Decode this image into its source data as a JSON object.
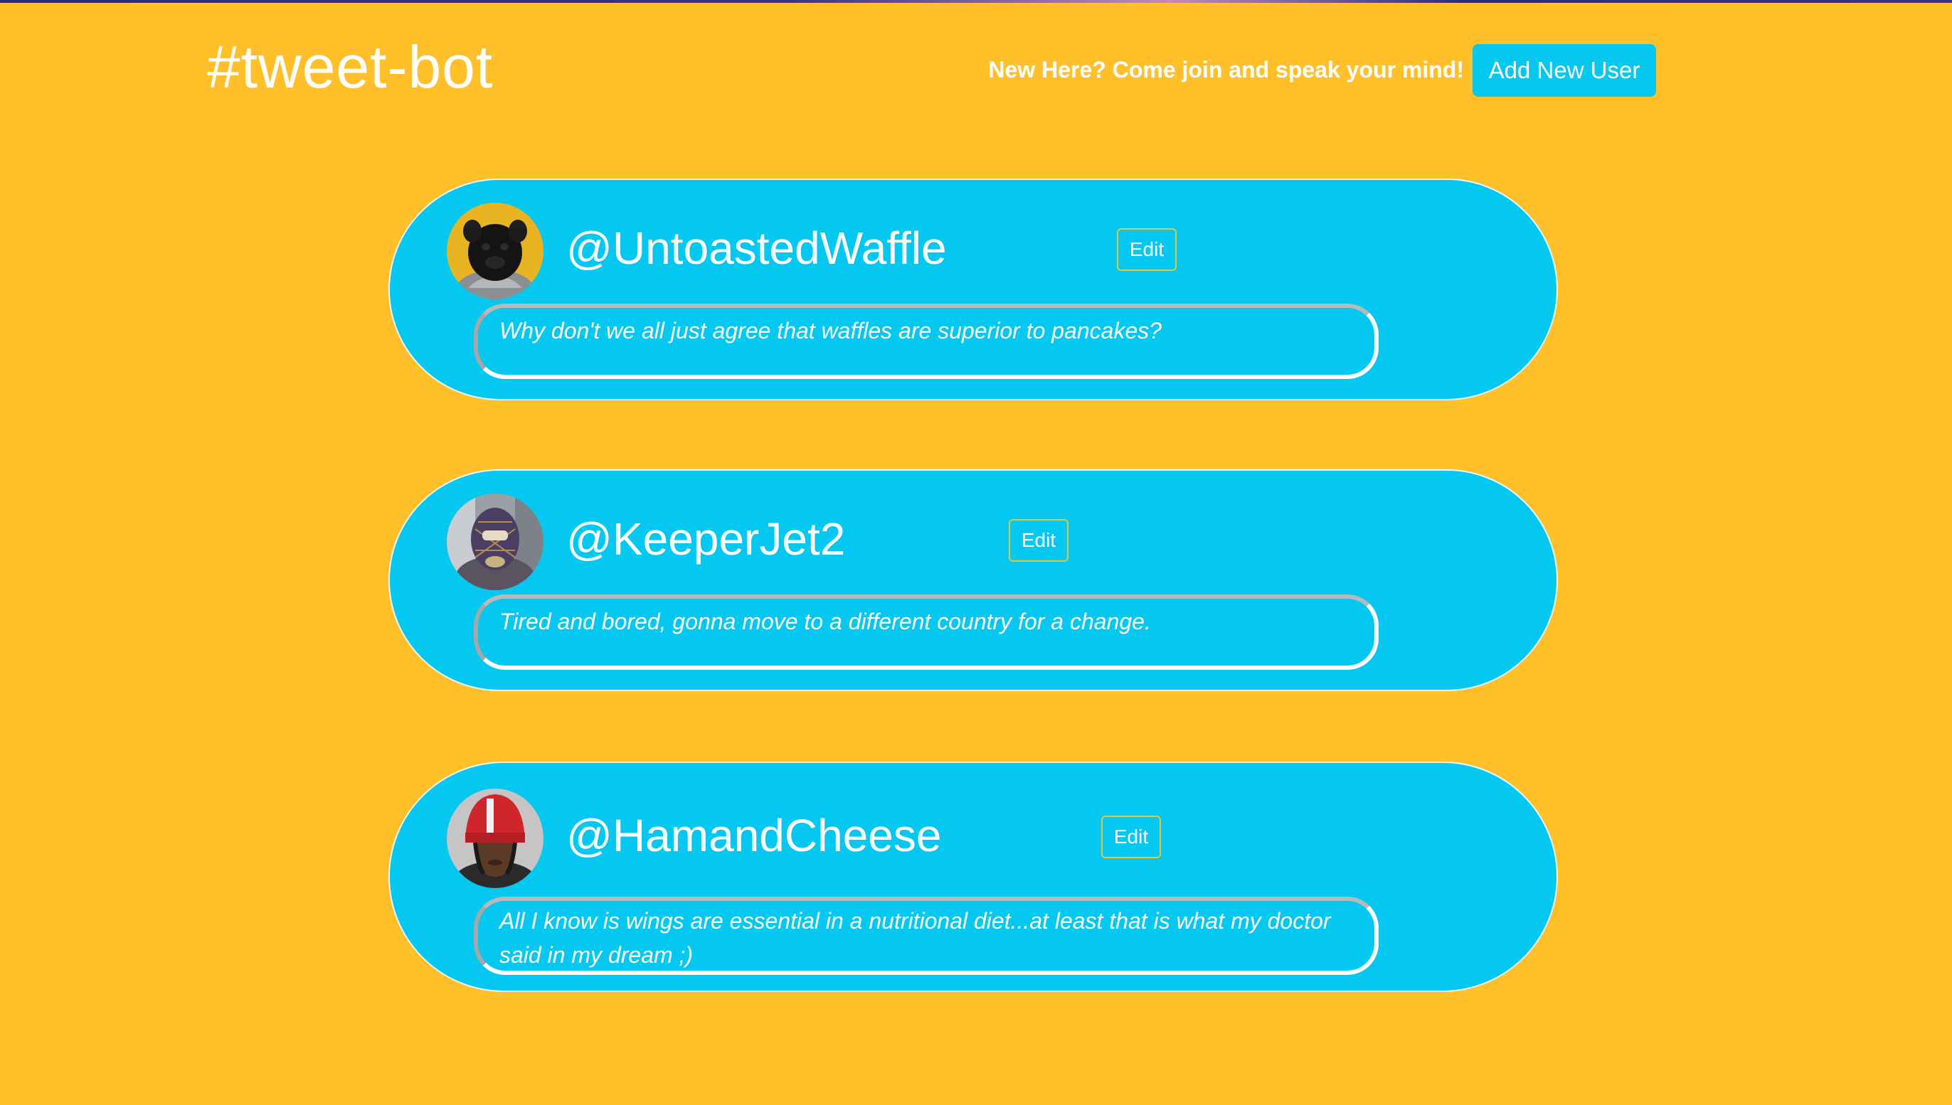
{
  "header": {
    "brand": "#tweet-bot",
    "cta_text": "New Here? Come join and speak your mind!",
    "add_user_label": "Add New User"
  },
  "users": [
    {
      "handle": "@UntoastedWaffle",
      "edit_label": "Edit",
      "tweet": "Why don't we all just agree that waffles are superior to pancakes?",
      "avatar": "pug-in-sweater-photo"
    },
    {
      "handle": "@KeeperJet2",
      "edit_label": "Edit",
      "tweet": "Tired and bored, gonna move to a different country for a change.",
      "avatar": "person-in-balaclava-photo"
    },
    {
      "handle": "@HamandCheese",
      "edit_label": "Edit",
      "tweet": "All I know is wings are essential in a nutritional diet...at least that is what my doctor said in my dream ;)",
      "avatar": "person-in-red-hat-photo"
    }
  ],
  "colors": {
    "background": "#FFC02A",
    "card": "#04C8EF",
    "button": "#06C8EF",
    "edit_border": "#E8C632",
    "text": "#FFFFFF"
  }
}
